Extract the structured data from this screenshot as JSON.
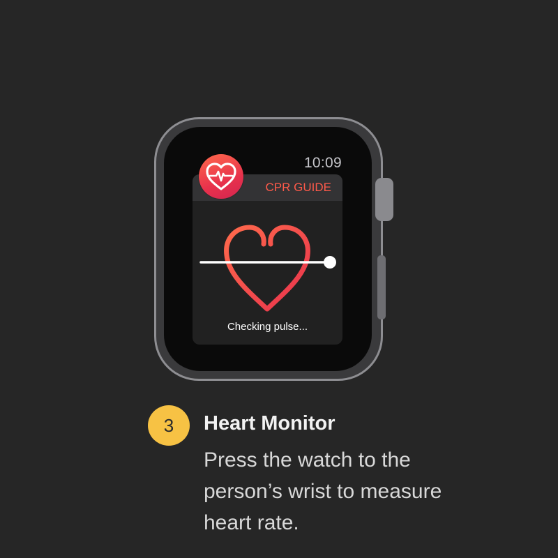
{
  "watch": {
    "time": "10:09",
    "app": {
      "title": "CPR GUIDE",
      "icon": "heart-pulse-icon",
      "status": "Checking pulse..."
    },
    "colors": {
      "accent": "#ff5a4a",
      "heart_gradient_start": "#ff6a4c",
      "heart_gradient_end": "#e8324c"
    }
  },
  "step": {
    "number": "3",
    "title": "Heart Monitor",
    "description": "Press the watch to the person’s wrist to measure heart rate.",
    "badge_color": "#f7c244"
  }
}
